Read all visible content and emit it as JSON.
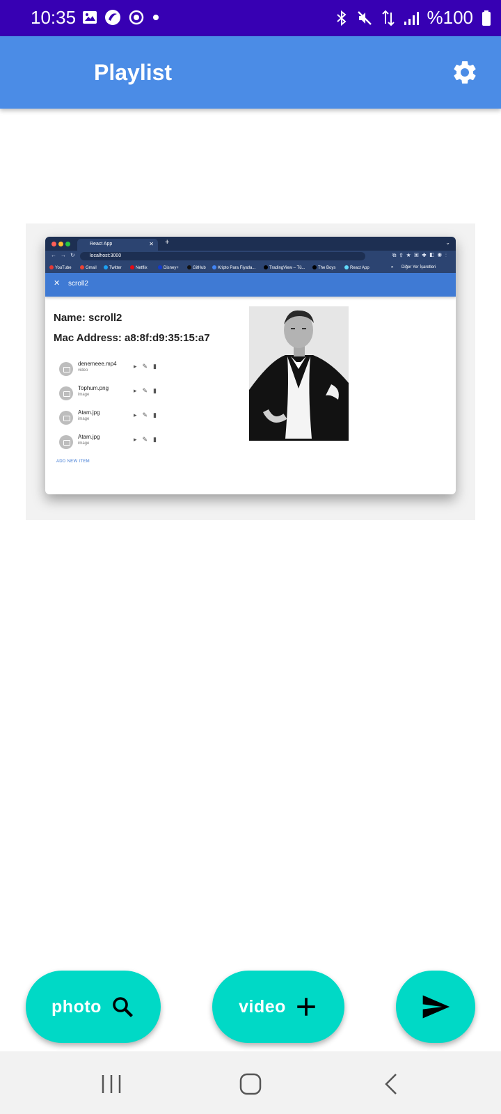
{
  "status_bar": {
    "time": "10:35",
    "battery": "%100"
  },
  "app_bar": {
    "title": "Playlist",
    "settings_icon": "gear-icon"
  },
  "screenshot": {
    "browser": {
      "tab_title": "React App",
      "url": "localhost:3000",
      "bookmarks": [
        "YouTube",
        "Gmail",
        "Twitter",
        "Netflix",
        "Disney+",
        "GitHub",
        "Kripto Para Fiyatla...",
        "TradingView – Tü...",
        "The Boys",
        "React App"
      ],
      "bookmarks_more": "»",
      "other_bookmarks": "Diğer Yer İşaretleri"
    },
    "page": {
      "header_title": "scroll2",
      "name_line": "Name: scroll2",
      "mac_line": "Mac Address: a8:8f:d9:35:15:a7",
      "items": [
        {
          "name": "denemeee.mp4",
          "type": "video"
        },
        {
          "name": "Tophum.png",
          "type": "image"
        },
        {
          "name": "Atam.jpg",
          "type": "image"
        },
        {
          "name": "Atam.jpg",
          "type": "image"
        }
      ],
      "add_new_label": "ADD NEW ITEM"
    }
  },
  "buttons": {
    "photo_label": "photo",
    "photo_icon": "search-icon",
    "video_label": "video",
    "video_icon": "plus-icon",
    "send_icon": "send-icon"
  },
  "colors": {
    "status_bar": "#3700b3",
    "app_bar": "#4b8ce6",
    "fab": "#00d9c6"
  }
}
